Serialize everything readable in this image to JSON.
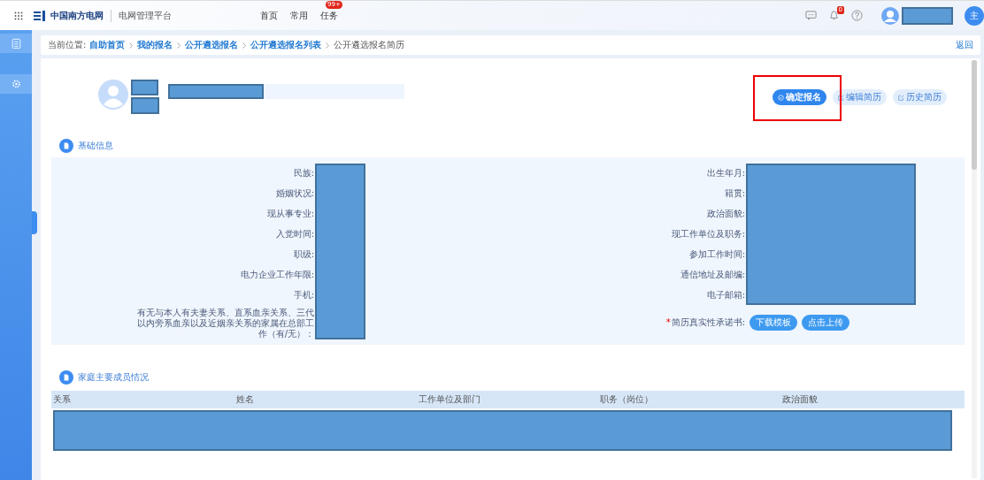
{
  "header": {
    "logo": "中国南方电网",
    "platform": "电网管理平台",
    "nav": [
      {
        "label": "首页"
      },
      {
        "label": "常用"
      },
      {
        "label": "任务",
        "badge": "99+"
      }
    ],
    "bell_badge": "0",
    "user_initial": "主"
  },
  "breadcrumb": {
    "prefix": "当前位置:",
    "items": [
      {
        "label": "自助首页",
        "link": true
      },
      {
        "label": "我的报名",
        "link": true
      },
      {
        "label": "公开遴选报名",
        "link": true
      },
      {
        "label": "公开遴选报名列表",
        "link": true
      },
      {
        "label": "公开遴选报名简历",
        "link": false
      }
    ],
    "back": "返回"
  },
  "actions": [
    {
      "label": "确定报名",
      "kind": "primary"
    },
    {
      "label": "编辑简历",
      "kind": "edit"
    },
    {
      "label": "历史简历",
      "kind": "edit"
    }
  ],
  "basic": {
    "title": "基础信息",
    "left": [
      "民族:",
      "婚姻状况:",
      "现从事专业:",
      "入党时间:",
      "职级:",
      "电力企业工作年限:",
      "手机:",
      "有无与本人有夫妻关系、直系血亲关系、三代以内旁系血亲以及近姻亲关系的家属在总部工作（有/无）："
    ],
    "right": [
      "出生年月:",
      "籍贯:",
      "政治面貌:",
      "现工作单位及职务:",
      "参加工作时间:",
      "通信地址及邮编:",
      "电子邮箱:"
    ],
    "pledge": {
      "label": "简历真实性承诺书:",
      "required_mark": "*",
      "buttons": [
        "下载模板",
        "点击上传"
      ]
    }
  },
  "family": {
    "title": "家庭主要成员情况",
    "columns": [
      "关系",
      "姓名",
      "工作单位及部门",
      "职务（岗位）",
      "政治面貌"
    ]
  }
}
